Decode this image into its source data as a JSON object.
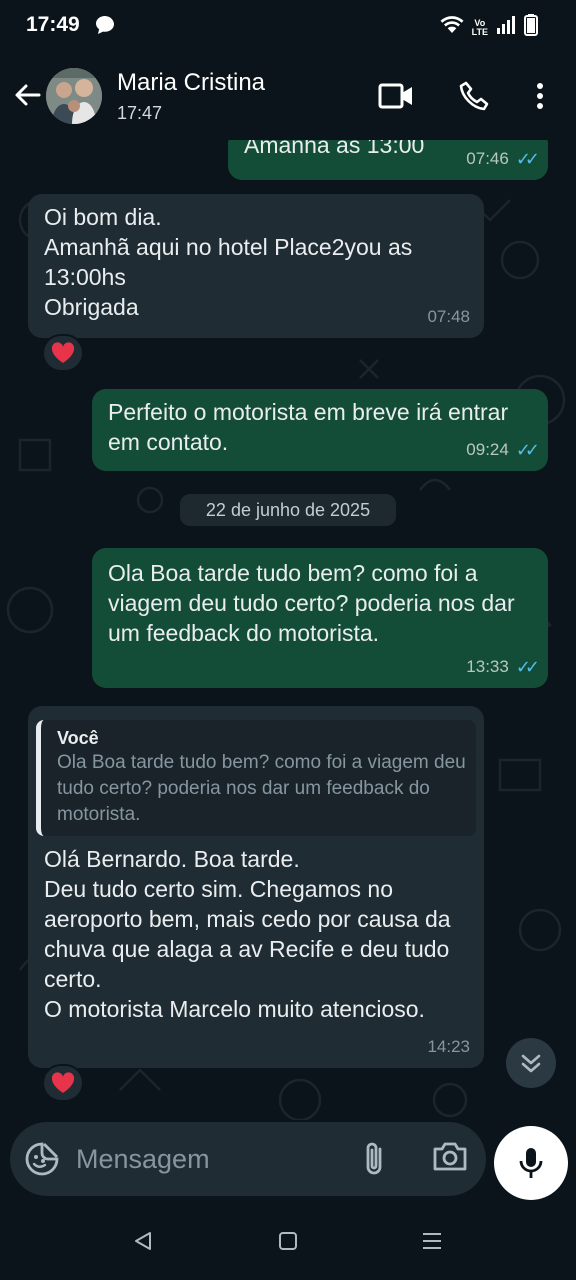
{
  "status_bar": {
    "time": "17:49",
    "volte_top": "Vo",
    "volte_bottom": "LTE"
  },
  "header": {
    "contact_name": "Maria Cristina",
    "last_seen": "17:47"
  },
  "messages": [
    {
      "text": "Amanhã as 13:00",
      "time": "07:46",
      "ticks": "✓✓"
    },
    {
      "text": "Oi bom dia.\nAmanhã aqui no hotel Place2you as 13:00hs\nObrigada",
      "time": "07:48",
      "reaction": "❤️"
    },
    {
      "text": "Perfeito o motorista em breve irá entrar em contato.",
      "time": "09:24",
      "ticks": "✓✓"
    },
    {
      "text": "Ola Boa tarde tudo bem? como foi a viagem deu tudo certo? poderia nos dar um feedback do motorista.",
      "time": "13:33",
      "ticks": "✓✓"
    },
    {
      "quote_author": "Você",
      "quote_text": "Ola Boa tarde tudo bem? como foi a viagem deu tudo certo? poderia nos dar um feedback do motorista.",
      "text": "Olá Bernardo. Boa tarde.\nDeu tudo certo sim. Chegamos no aeroporto bem, mais cedo por causa da chuva que alaga a av Recife e deu tudo certo.\nO motorista Marcelo muito atencioso.",
      "time": "14:23",
      "reaction": "❤️"
    }
  ],
  "date_separator": "22 de junho de 2025",
  "composer": {
    "placeholder": "Mensagem"
  },
  "colors": {
    "background": "#0b141a",
    "outgoing_bubble": "#144d37",
    "incoming_bubble": "#202c33",
    "read_ticks": "#53bdeb",
    "heart": "#e8344a"
  },
  "icons": [
    "back-arrow-icon",
    "video-call-icon",
    "phone-icon",
    "more-vert-icon",
    "emoji-sticker-icon",
    "attach-icon",
    "camera-icon",
    "mic-icon",
    "scroll-down-icon",
    "nav-back-icon",
    "nav-home-icon",
    "nav-menu-icon"
  ]
}
